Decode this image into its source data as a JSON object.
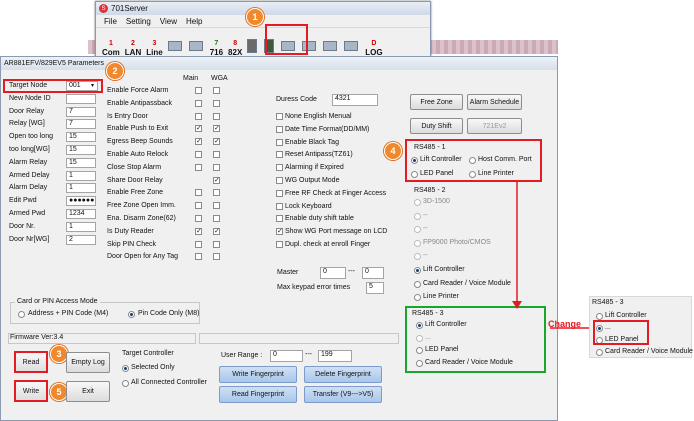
{
  "top_window": {
    "title": "701Server",
    "menu": [
      "File",
      "Setting",
      "View",
      "Help"
    ],
    "toolbar": [
      {
        "num": "1",
        "label": "Com"
      },
      {
        "num": "2",
        "label": "LAN"
      },
      {
        "num": "3",
        "label": "Line"
      },
      {
        "num": "7",
        "label": "716"
      },
      {
        "num": "8",
        "label": "82X"
      },
      {
        "num": "D",
        "label": "LOG"
      }
    ]
  },
  "dialog": {
    "title": "AR881EFV/829EV5 Parameters",
    "left_fields": [
      {
        "label": "Target Node",
        "value": "001"
      },
      {
        "label": "New Node ID",
        "value": ""
      },
      {
        "label": "Door Relay",
        "value": "7"
      },
      {
        "label": "Relay [WG]",
        "value": "7"
      },
      {
        "label": "Open too long",
        "value": "15"
      },
      {
        "label": "too long[WG]",
        "value": "15"
      },
      {
        "label": "Alarm Relay",
        "value": "15"
      },
      {
        "label": "Armed Delay",
        "value": "1"
      },
      {
        "label": "Alarm Delay",
        "value": "1"
      },
      {
        "label": "Edit Pwd",
        "value": "●●●●●●"
      },
      {
        "label": "Armed Pwd",
        "value": "1234"
      },
      {
        "label": "Door Nr.",
        "value": "1"
      },
      {
        "label": "Door Nr[WG]",
        "value": "2"
      }
    ],
    "col_headers": {
      "main": "Main",
      "wga": "WGA"
    },
    "options": [
      {
        "label": "Enable Force Alarm",
        "main": false,
        "wga": false
      },
      {
        "label": "Enable Antipassback",
        "main": false,
        "wga": false
      },
      {
        "label": "Is Entry Door",
        "main": false,
        "wga": false
      },
      {
        "label": "Enable Push to Exit",
        "main": true,
        "wga": true
      },
      {
        "label": "Egress Beep Sounds",
        "main": true,
        "wga": true
      },
      {
        "label": "Enable Auto Relock",
        "main": false,
        "wga": false
      },
      {
        "label": "Close Stop Alarm",
        "main": false,
        "wga": false
      },
      {
        "label": "Share Door Relay",
        "main": null,
        "wga": true
      },
      {
        "label": "Enable Free Zone",
        "main": false,
        "wga": false
      },
      {
        "label": "Free Zone Open Imm.",
        "main": false,
        "wga": false
      },
      {
        "label": "Ena. Disarm Zone(62)",
        "main": false,
        "wga": false
      },
      {
        "label": "Is Duty Reader",
        "main": true,
        "wga": true
      },
      {
        "label": "Skip PIN Check",
        "main": false,
        "wga": false
      },
      {
        "label": "Door Open for Any Tag",
        "main": false,
        "wga": false
      }
    ],
    "duress": {
      "label": "Duress Code",
      "value": "4321"
    },
    "right_options": [
      {
        "label": "None English Menual",
        "checked": false
      },
      {
        "label": "Date Time Format(DD/MM)",
        "checked": false
      },
      {
        "label": "Enable Black Tag",
        "checked": false
      },
      {
        "label": "Reset Antipass(TZ61)",
        "checked": false
      },
      {
        "label": "Alarming if Expired",
        "checked": false
      },
      {
        "label": "WG Output Mode",
        "checked": false
      },
      {
        "label": "Free RF Check at Finger Access",
        "checked": false
      },
      {
        "label": "Lock Keyboard",
        "checked": false
      },
      {
        "label": "Enable duty shift table",
        "checked": false
      },
      {
        "label": "Show WG Port message on LCD",
        "checked": true
      },
      {
        "label": "Dupl. check at enroll  Finger",
        "checked": false
      }
    ],
    "master": {
      "label": "Master",
      "from": "0",
      "to": "0",
      "sep": "---"
    },
    "keypad": {
      "label": "Max keypad error times",
      "value": "5"
    },
    "buttons_right": {
      "free_zone": "Free Zone",
      "alarm_schedule": "Alarm Schedule",
      "duty_shift": "Duty Shift",
      "model": "721Ev2"
    },
    "rs485_1": {
      "title": "RS485 - 1",
      "options": [
        {
          "label": "Lift Controller",
          "selected": true
        },
        {
          "label": "Host Comm. Port",
          "selected": false
        },
        {
          "label": "LED Panel",
          "selected": false
        },
        {
          "label": "Line Printer",
          "selected": false
        }
      ]
    },
    "rs485_2": {
      "title": "RS485 - 2",
      "options": [
        {
          "label": "3D-1500",
          "selected": false,
          "disabled": true
        },
        {
          "label": "--",
          "selected": false,
          "disabled": true
        },
        {
          "label": "--",
          "selected": false,
          "disabled": true
        },
        {
          "label": "FP9000 Photo/CMOS",
          "selected": false,
          "disabled": true
        },
        {
          "label": "--",
          "selected": false,
          "disabled": true
        },
        {
          "label": "Lift Controller",
          "selected": true,
          "disabled": false
        },
        {
          "label": "Card Reader / Voice Module",
          "selected": false,
          "disabled": false
        },
        {
          "label": "Line Printer",
          "selected": false,
          "disabled": false
        }
      ]
    },
    "rs485_3": {
      "title": "RS485 - 3",
      "options": [
        {
          "label": "Lift Controller",
          "selected": true,
          "disabled": false
        },
        {
          "label": "...",
          "selected": false,
          "disabled": true
        },
        {
          "label": "LED Panel",
          "selected": false,
          "disabled": false
        },
        {
          "label": "Card Reader / Voice Module",
          "selected": false,
          "disabled": false
        }
      ]
    },
    "access_mode": {
      "title": "Card or PIN Access Mode",
      "options": [
        {
          "label": "Address + PIN Code (M4)",
          "selected": false
        },
        {
          "label": "Pin Code Only (M8)",
          "selected": true
        }
      ]
    },
    "firmware": "Firmware Ver:3.4",
    "target_controller": {
      "title": "Target Controller",
      "options": [
        {
          "label": "Selected Only",
          "selected": true
        },
        {
          "label": "All Connected Controller",
          "selected": false
        }
      ]
    },
    "user_range": {
      "label": "User Range :",
      "from": "0",
      "sep": "---",
      "to": "199"
    },
    "bottom_buttons": {
      "read": "Read",
      "empty_log": "Empty Log",
      "write": "Write",
      "exit": "Exit",
      "write_fp": "Write Fingerprint",
      "delete_fp": "Delete Fingerprint",
      "read_fp": "Read Fingerprint",
      "transfer": "Transfer (V9--->V5)"
    }
  },
  "side_panel": {
    "title": "RS485 - 3",
    "options": [
      {
        "label": "Lift Controller",
        "selected": false
      },
      {
        "label": "...",
        "selected": true
      },
      {
        "label": "LED Panel",
        "selected": false
      },
      {
        "label": "Card Reader / Voice Module",
        "selected": false
      }
    ]
  },
  "annotations": {
    "change": "Change",
    "steps": [
      "1",
      "2",
      "3",
      "4",
      "5"
    ]
  },
  "colors": {
    "highlight_red": "#e31b23",
    "highlight_green": "#1aa52e",
    "badge": "#f0892e"
  }
}
